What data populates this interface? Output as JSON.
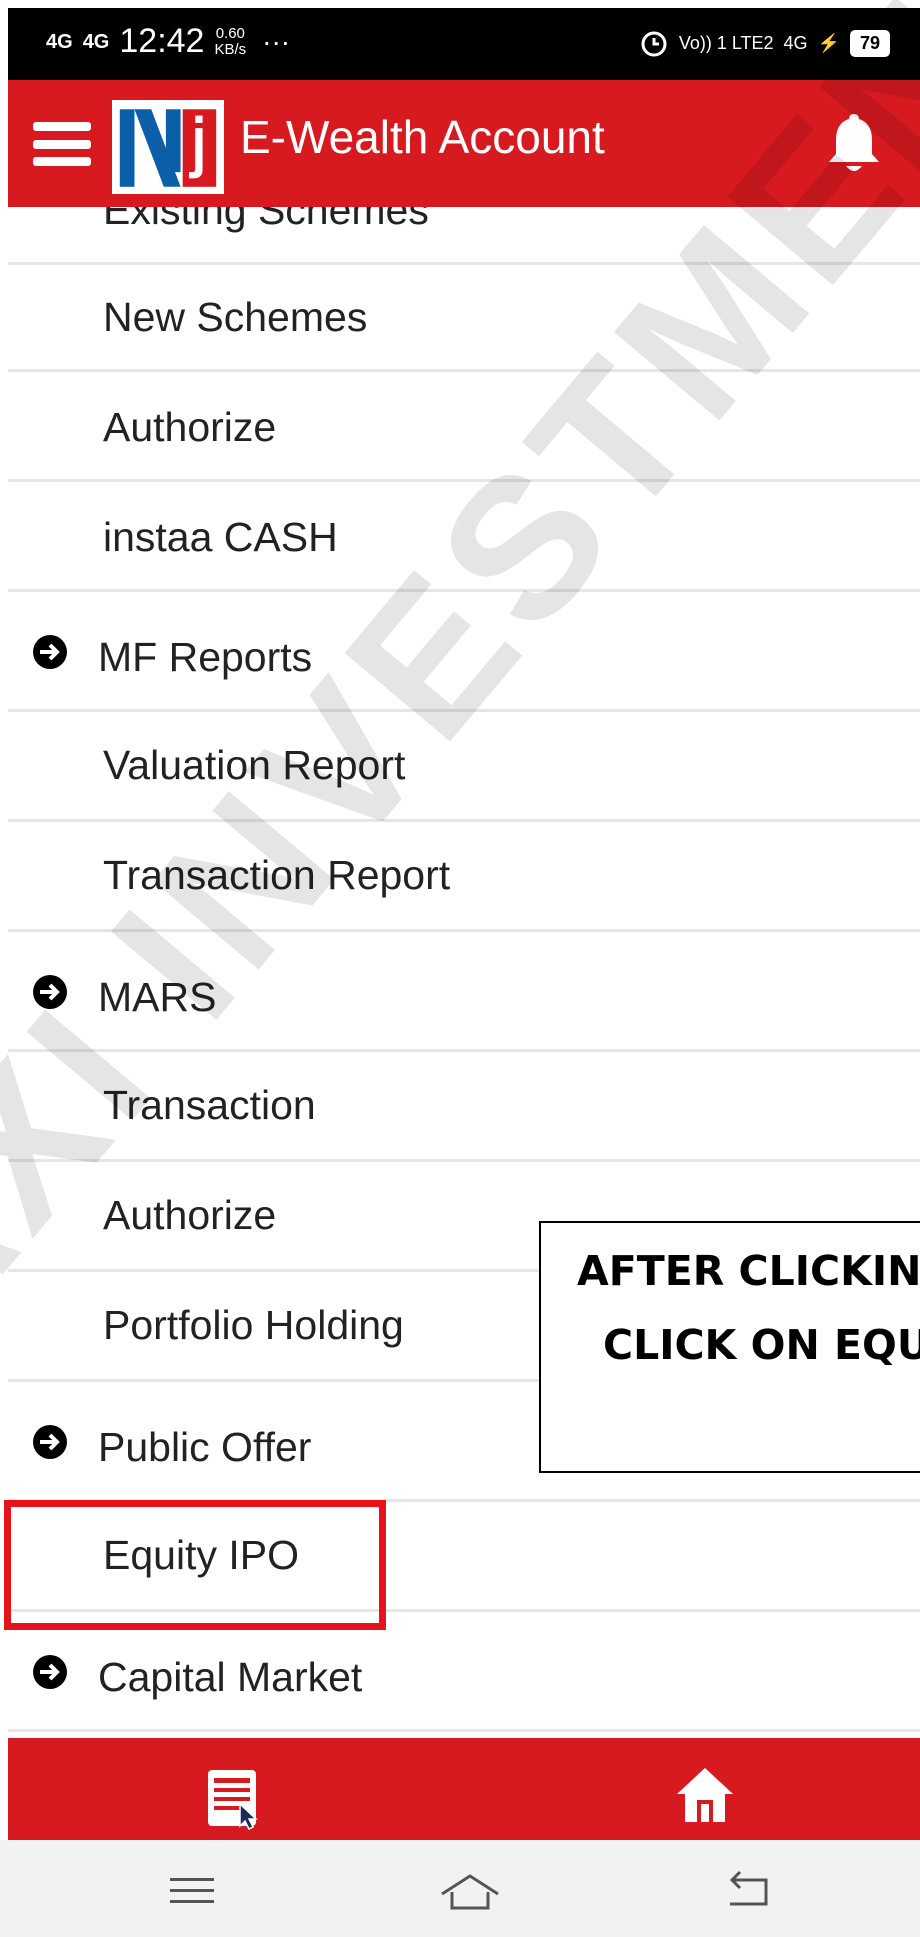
{
  "status_bar": {
    "signal_1": "4G",
    "signal_2": "4G",
    "time": "12:42",
    "speed_value": "0.60",
    "speed_unit": "KB/s",
    "overflow": "···",
    "network": "Vo)) 1 LTE2",
    "network_2": "4G",
    "battery": "79"
  },
  "app_bar": {
    "title": "E-Wealth Account"
  },
  "menu": {
    "items": [
      {
        "label": "Existing Schemes",
        "type": "sub"
      },
      {
        "label": "New Schemes",
        "type": "sub"
      },
      {
        "label": "Authorize",
        "type": "sub"
      },
      {
        "label": "instaa CASH",
        "type": "sub"
      },
      {
        "label": "MF Reports",
        "type": "head"
      },
      {
        "label": "Valuation Report",
        "type": "sub"
      },
      {
        "label": "Transaction Report",
        "type": "sub"
      },
      {
        "label": "MARS",
        "type": "head"
      },
      {
        "label": "Transaction",
        "type": "sub"
      },
      {
        "label": "Authorize",
        "type": "sub"
      },
      {
        "label": "Portfolio Holding",
        "type": "sub"
      },
      {
        "label": "Public Offer",
        "type": "head"
      },
      {
        "label": "Equity IPO",
        "type": "sub"
      },
      {
        "label": "Capital Market",
        "type": "head"
      }
    ]
  },
  "overlay": {
    "watermark": "AXI INVESTMENT",
    "callout_line1": "AFTER CLICKING",
    "callout_line2": "CLICK ON EQU"
  },
  "colors": {
    "brand_red": "#d71920",
    "highlight_red": "#e8131a",
    "divider": "#e6e6e6"
  },
  "icons": {
    "menu": "hamburger-menu-icon",
    "notification": "bell-icon",
    "bullet": "arrow-circle-right-icon",
    "nav_list": "list-document-icon",
    "nav_home": "home-icon",
    "sys_menu": "menu-lines-icon",
    "sys_home": "home-outline-icon",
    "sys_back": "back-arrow-icon"
  }
}
